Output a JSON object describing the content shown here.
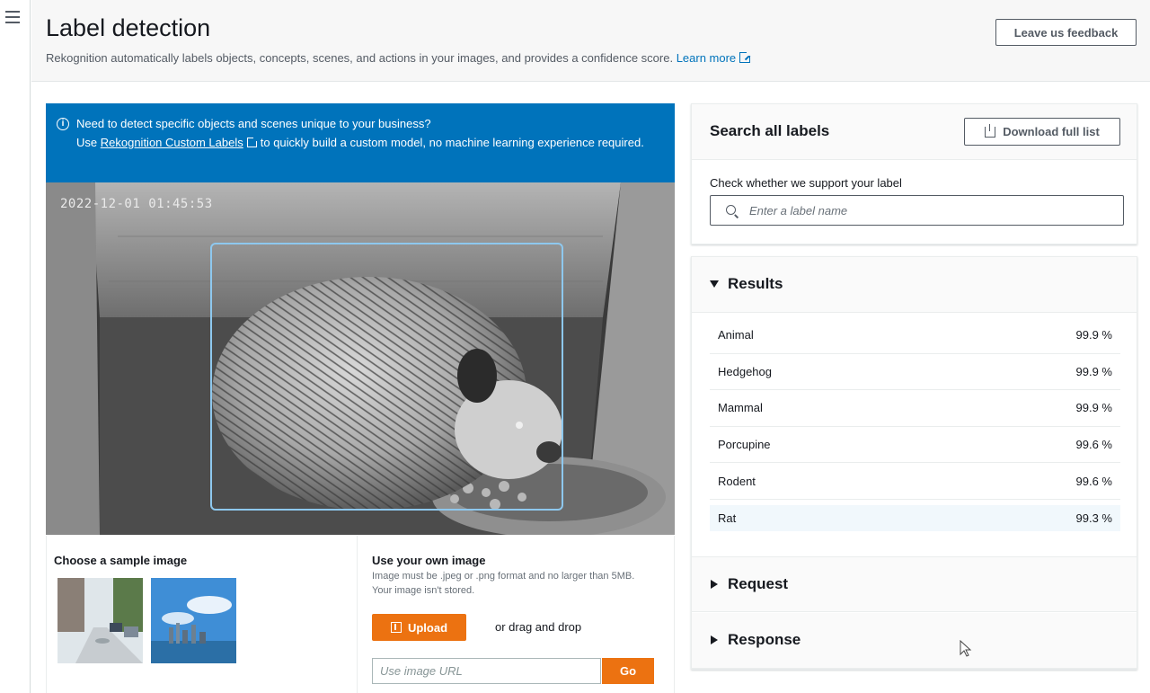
{
  "header": {
    "title": "Label detection",
    "description": "Rekognition automatically labels objects, concepts, scenes, and actions in your images, and provides a confidence score.",
    "learn_more": "Learn more",
    "feedback_button": "Leave us feedback"
  },
  "banner": {
    "line1": "Need to detect specific objects and scenes unique to your business?",
    "use": "Use",
    "link": "Rekognition Custom Labels",
    "rest": "to quickly build a custom model, no machine learning experience required."
  },
  "image": {
    "timestamp": "2022-12-01 01:45:53"
  },
  "sample_panel": {
    "title": "Choose a sample image"
  },
  "own_image": {
    "title": "Use your own image",
    "hint_line1": "Image must be .jpeg or .png format and no larger than 5MB.",
    "hint_line2": "Your image isn't stored.",
    "upload_button": "Upload",
    "drag_text": "or drag and drop",
    "url_placeholder": "Use image URL",
    "go_button": "Go"
  },
  "search": {
    "title": "Search all labels",
    "download_button": "Download full list",
    "field_label": "Check whether we support your label",
    "placeholder": "Enter a label name"
  },
  "results": {
    "title": "Results",
    "items": [
      {
        "label": "Animal",
        "confidence": "99.9 %"
      },
      {
        "label": "Hedgehog",
        "confidence": "99.9 %"
      },
      {
        "label": "Mammal",
        "confidence": "99.9 %"
      },
      {
        "label": "Porcupine",
        "confidence": "99.6 %"
      },
      {
        "label": "Rodent",
        "confidence": "99.6 %"
      },
      {
        "label": "Rat",
        "confidence": "99.3 %"
      }
    ]
  },
  "request": {
    "title": "Request"
  },
  "response": {
    "title": "Response"
  },
  "colors": {
    "accent": "#ec7211",
    "banner": "#0073bb",
    "link": "#0073bb",
    "bbox": "#8ec8ee"
  }
}
